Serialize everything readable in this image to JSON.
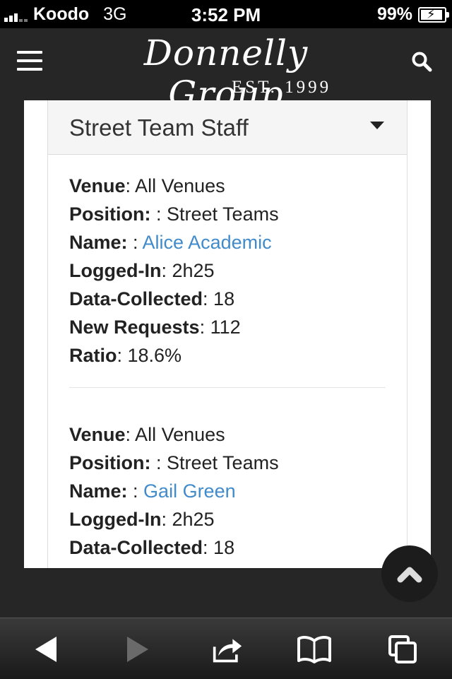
{
  "status_bar": {
    "carrier": "Koodo",
    "network": "3G",
    "time": "3:52 PM",
    "battery": "99%",
    "battery_level": 0.99
  },
  "header": {
    "logo_script": "Donnelly Group",
    "logo_est": "EST. 1999",
    "menu_icon": "hamburger-menu-icon",
    "search_icon": "search-icon"
  },
  "panel": {
    "title": "Street Team Staff",
    "caret_icon": "caret-down-icon"
  },
  "labels": {
    "venue": "Venue",
    "position": "Position:",
    "name": "Name:",
    "logged_in": "Logged-In",
    "data_collected": "Data-Collected",
    "new_requests": "New Requests",
    "ratio": "Ratio"
  },
  "entries": [
    {
      "venue": ": All Venues",
      "position": " : Street Teams",
      "name_sep": " : ",
      "name": "Alice Academic",
      "logged_in": ": 2h25",
      "data_collected": ": 18",
      "new_requests": ": 112",
      "ratio": ": 18.6%"
    },
    {
      "venue": ": All Venues",
      "position": " : Street Teams",
      "name_sep": " : ",
      "name": "Gail Green",
      "logged_in": ": 2h25",
      "data_collected": ": 18"
    }
  ],
  "scroll_top_icon": "chevron-up-icon",
  "browser_toolbar": {
    "icons": [
      "back-arrow-icon",
      "forward-arrow-icon",
      "share-icon",
      "bookmarks-icon",
      "tabs-icon"
    ]
  },
  "colors": {
    "header_bg": "#262626",
    "link": "#428bca",
    "panel_header_bg": "#f5f5f5"
  }
}
